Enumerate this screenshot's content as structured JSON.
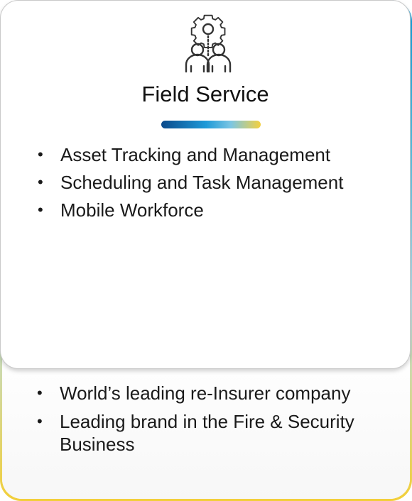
{
  "card": {
    "icon": "gear-team-icon",
    "title": "Field Service",
    "items": [
      "Asset Tracking and Management",
      "Scheduling and Task Management",
      "Mobile Workforce"
    ]
  },
  "footer": {
    "items": [
      "World’s leading re-Insurer company",
      "Leading brand in the Fire & Security Business"
    ]
  },
  "colors": {
    "accent_dark": "#0b4a8b",
    "accent_blue": "#1e9ad8",
    "accent_yellow": "#f4d03f"
  }
}
